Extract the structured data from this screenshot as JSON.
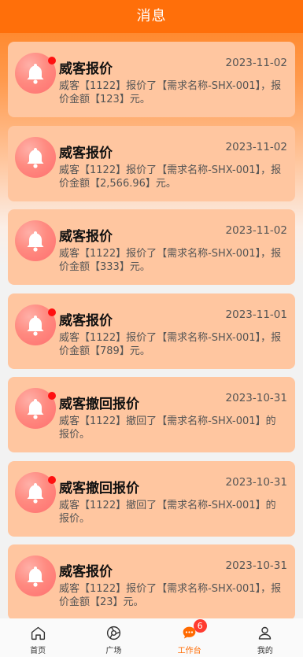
{
  "header": {
    "title": "消息"
  },
  "messages": [
    {
      "title": "威客报价",
      "date": "2023-11-02",
      "text": "威客【1122】报价了【需求名称-SHX-001】，报价金额【123】元。",
      "unread": true
    },
    {
      "title": "威客报价",
      "date": "2023-11-02",
      "text": "威客【1122】报价了【需求名称-SHX-001】，报价金额【2,566.96】元。",
      "unread": false
    },
    {
      "title": "威客报价",
      "date": "2023-11-02",
      "text": "威客【1122】报价了【需求名称-SHX-001】，报价金额【333】元。",
      "unread": false
    },
    {
      "title": "威客报价",
      "date": "2023-11-01",
      "text": "威客【1122】报价了【需求名称-SHX-001】，报价金额【789】元。",
      "unread": true
    },
    {
      "title": "威客撤回报价",
      "date": "2023-10-31",
      "text": "威客【1122】撤回了【需求名称-SHX-001】的报价。",
      "unread": true
    },
    {
      "title": "威客撤回报价",
      "date": "2023-10-31",
      "text": "威客【1122】撤回了【需求名称-SHX-001】的报价。",
      "unread": true
    },
    {
      "title": "威客报价",
      "date": "2023-10-31",
      "text": "威客【1122】报价了【需求名称-SHX-001】，报价金额【23】元。",
      "unread": false
    }
  ],
  "tabbar": {
    "items": [
      {
        "label": "首页",
        "icon": "home-icon"
      },
      {
        "label": "广场",
        "icon": "plaza-icon"
      },
      {
        "label": "工作台",
        "icon": "chat-bubble-icon",
        "badge": "6",
        "active": true
      },
      {
        "label": "我的",
        "icon": "user-icon"
      }
    ]
  },
  "colors": {
    "header": "#ff6f0a",
    "card": "#ffc6a0",
    "accent": "#ff6a00",
    "unread_dot": "#ff1010",
    "badge": "#ff3b30"
  }
}
